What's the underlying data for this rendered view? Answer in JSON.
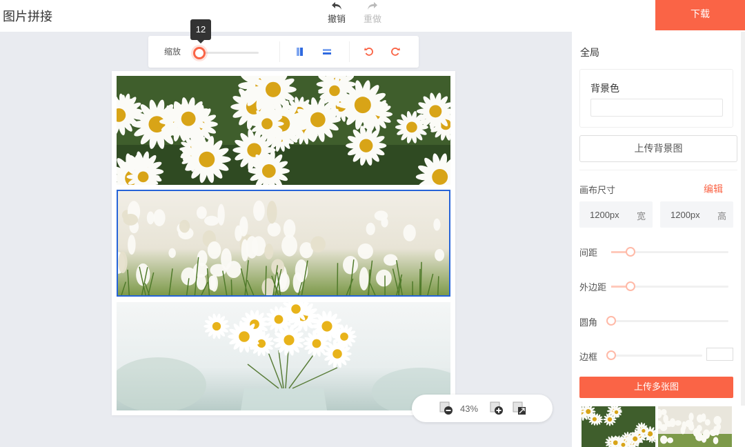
{
  "app": {
    "title": "图片拼接"
  },
  "history": {
    "undo_label": "撤销",
    "redo_label": "重做"
  },
  "header": {
    "download_label": "下载"
  },
  "toolbar": {
    "zoom_label": "缩放",
    "zoom_slider_value": 12,
    "zoom_tooltip": "12",
    "icons": [
      "layout-vertical-icon",
      "layout-horizontal-icon",
      "rotate-left-icon",
      "rotate-right-icon"
    ]
  },
  "canvas": {
    "tiles": [
      {
        "name": "daisies-field",
        "selected": false
      },
      {
        "name": "white-crocus-flowers",
        "selected": true
      },
      {
        "name": "daisies-in-glass",
        "selected": false
      }
    ]
  },
  "zoom_control": {
    "value": "43%",
    "icons": [
      "zoom-out-icon",
      "zoom-in-icon",
      "fit-screen-icon"
    ]
  },
  "panel": {
    "section_title": "全局",
    "background_color_label": "背景色",
    "upload_background_label": "上传背景图",
    "canvas_size_label": "画布尺寸",
    "edit_label": "编辑",
    "width": {
      "value": "1200px",
      "unit": "宽"
    },
    "height": {
      "value": "1200px",
      "unit": "高"
    },
    "spacing_label": "间距",
    "outer_margin_label": "外边距",
    "corner_label": "圆角",
    "border_label": "边框",
    "spacing_level": 0.18,
    "outer_margin_level": 0.18,
    "corner_level": 0,
    "border_level": 0,
    "upload_many_label": "上传多张图"
  },
  "colors": {
    "accent": "#fa6446",
    "selection": "#2563d8"
  }
}
